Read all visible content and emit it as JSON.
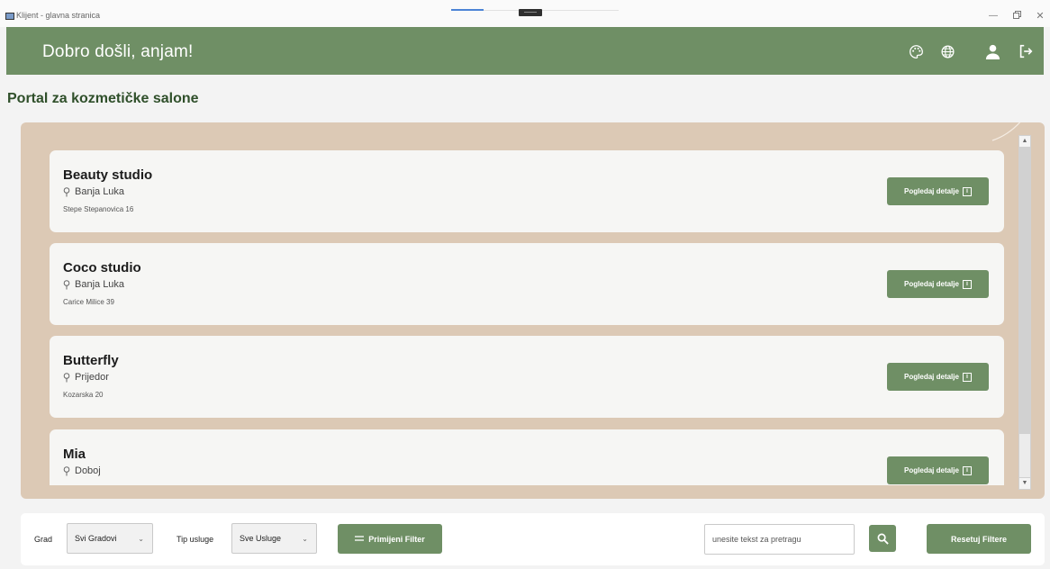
{
  "window": {
    "title": "Klijent - glavna stranica"
  },
  "header": {
    "welcome": "Dobro došli, anjam!",
    "icons": [
      "palette-icon",
      "globe-icon",
      "user-icon",
      "logout-icon"
    ],
    "background": "#6f8f65"
  },
  "page_title": "Portal za kozmetičke salone",
  "salons": [
    {
      "name": "Beauty studio",
      "city": "Banja Luka",
      "address": "Stepe Stepanovica 16",
      "button": "Pogledaj detalje"
    },
    {
      "name": "Coco studio",
      "city": "Banja Luka",
      "address": "Carice Milice 39",
      "button": "Pogledaj detalje"
    },
    {
      "name": "Butterfly",
      "city": "Prijedor",
      "address": "Kozarska 20",
      "button": "Pogledaj detalje"
    },
    {
      "name": "Mia",
      "city": "Doboj",
      "address": "",
      "button": "Pogledaj detalje"
    }
  ],
  "filters": {
    "city_label": "Grad",
    "city_value": "Svi Gradovi",
    "service_label": "Tip usluge",
    "service_value": "Sve Usluge",
    "apply_label": "Primijeni Filter",
    "search_placeholder": "unesite tekst za pretragu",
    "reset_label": "Resetuj Filtere"
  },
  "colors": {
    "accent": "#6f8f65",
    "panel": "#dcc9b5",
    "title": "#2f4f2a"
  }
}
